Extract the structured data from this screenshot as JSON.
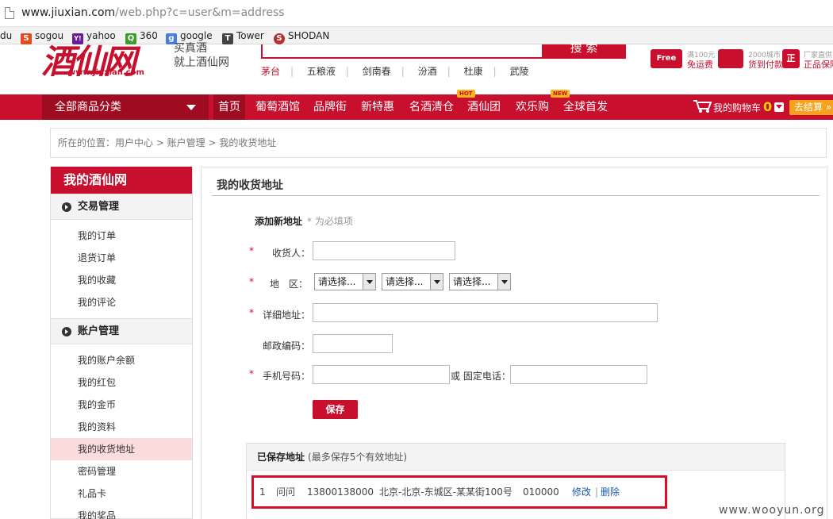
{
  "browser": {
    "url_host": "www.jiuxian.com",
    "url_path": "/web.php?c=user&m=address",
    "bookmarks": [
      {
        "label": "du"
      },
      {
        "label": "sogou",
        "glyph": "S",
        "color": "#e34b22"
      },
      {
        "label": "yahoo",
        "glyph": "Y!",
        "color": "#6a1b9a"
      },
      {
        "label": "360",
        "glyph": "Q",
        "color": "#3a9d2e"
      },
      {
        "label": "google",
        "glyph": "g",
        "color": "#4a7fd9"
      },
      {
        "label": "Tower",
        "glyph": "T",
        "color": "#444444"
      },
      {
        "label": "SHODAN",
        "glyph": "S",
        "color": "#b5312c"
      }
    ]
  },
  "header": {
    "logo_text": "酒仙网",
    "logo_domain": "www.Jiuxian.com",
    "slogan_line1": "买真酒",
    "slogan_line2": "就上酒仙网",
    "search_button": "搜 索",
    "hot_words": [
      "茅台",
      "五粮液",
      "剑南春",
      "汾酒",
      "杜康",
      "武陵"
    ],
    "promos": [
      {
        "icon": "Free",
        "top": "满100元",
        "bottom": "免运费"
      },
      {
        "icon": "",
        "top": "2000城市",
        "bottom": "货到付款"
      },
      {
        "icon": "正",
        "top": "厂家直供",
        "bottom": "正品保障"
      }
    ]
  },
  "nav": {
    "category_button": "全部商品分类",
    "items": [
      {
        "label": "首页",
        "active": true
      },
      {
        "label": "葡萄酒馆"
      },
      {
        "label": "品牌街"
      },
      {
        "label": "新特惠"
      },
      {
        "label": "名酒清仓",
        "badge": "HOT"
      },
      {
        "label": "酒仙团"
      },
      {
        "label": "欢乐购",
        "badge": "NEW"
      },
      {
        "label": "全球首发"
      }
    ],
    "cart_label": "我的购物车",
    "cart_count": "0",
    "checkout": "去结算 »"
  },
  "breadcrumb": "所在的位置：用户中心 > 账户管理 > 我的收货地址",
  "sidebar": {
    "title": "我的酒仙网",
    "groups": [
      {
        "label": "交易管理",
        "items": [
          "我的订单",
          "退货订单",
          "我的收藏",
          "我的评论"
        ]
      },
      {
        "label": "账户管理",
        "items": [
          "我的账户余额",
          "我的红包",
          "我的金币",
          "我的资料",
          "我的收货地址",
          "密码管理",
          "礼品卡",
          "我的奖品"
        ]
      }
    ],
    "active_item": "我的收货地址"
  },
  "main": {
    "title": "我的收货地址",
    "form_title": "添加新地址",
    "required_hint": "* 为必填项",
    "labels": {
      "receiver": "收货人：",
      "region": "地　区：",
      "address": "详细地址：",
      "zip": "邮政编码：",
      "mobile": "手机号码：",
      "phone": "或 固定电话："
    },
    "region_selects": [
      "请选择...",
      "请选择...",
      "请选择..."
    ],
    "save_button": "保存",
    "saved_title": "已保存地址",
    "saved_hint": "(最多保存5个有效地址)",
    "saved_rows": [
      {
        "index": "1",
        "name": "问问",
        "phone": "13800138000",
        "address": "北京-北京-东城区-某某街100号",
        "zip": "010000",
        "edit": "修改",
        "sep": "|",
        "delete": "删除"
      }
    ]
  },
  "watermark": "www.wooyun.org"
}
